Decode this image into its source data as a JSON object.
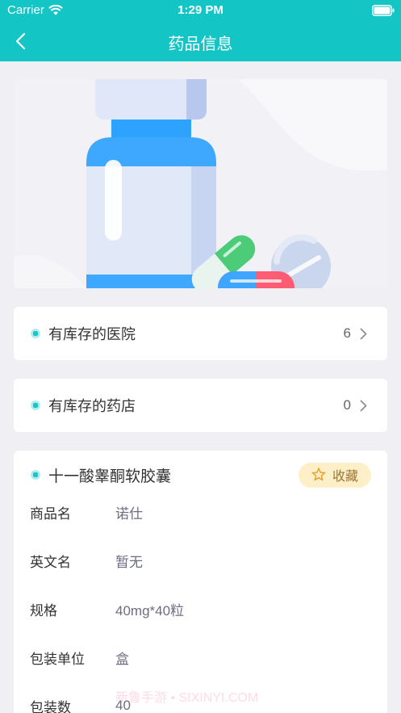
{
  "status_bar": {
    "carrier": "Carrier",
    "time": "1:29 PM",
    "wifi_icon": "wifi-icon",
    "battery_icon": "battery-icon",
    "battery_level": 1.0
  },
  "nav": {
    "title": "药品信息",
    "back_icon": "chevron-left-icon"
  },
  "hero_image": {
    "icon": "medicine-bottle-illustration"
  },
  "stock_links": [
    {
      "label": "有库存的医院",
      "count": "6",
      "icon": "chevron-right-icon"
    },
    {
      "label": "有库存的药店",
      "count": "0",
      "icon": "chevron-right-icon"
    }
  ],
  "drug": {
    "name": "十一酸睾酮软胶囊",
    "favorite": {
      "label": "收藏",
      "icon": "star-icon"
    },
    "fields": [
      {
        "label": "商品名",
        "value": "诺仕"
      },
      {
        "label": "英文名",
        "value": "暂无"
      },
      {
        "label": "规格",
        "value": "40mg*40粒"
      },
      {
        "label": "包装单位",
        "value": "盒"
      },
      {
        "label": "包装数",
        "value": "40"
      }
    ]
  },
  "watermark": "新鲁手游 • SIXINYI.COM",
  "colors": {
    "header": "#14C5C6",
    "page_bg": "#EFEFF4",
    "dot": "#1AC6C6",
    "dot_ring": "#B3ECEC",
    "favorite_bg": "#FDEFC8",
    "favorite_text": "#9C7530",
    "favorite_star": "#EBA63A",
    "label_text": "#333333",
    "value_text": "#6B6E80"
  }
}
